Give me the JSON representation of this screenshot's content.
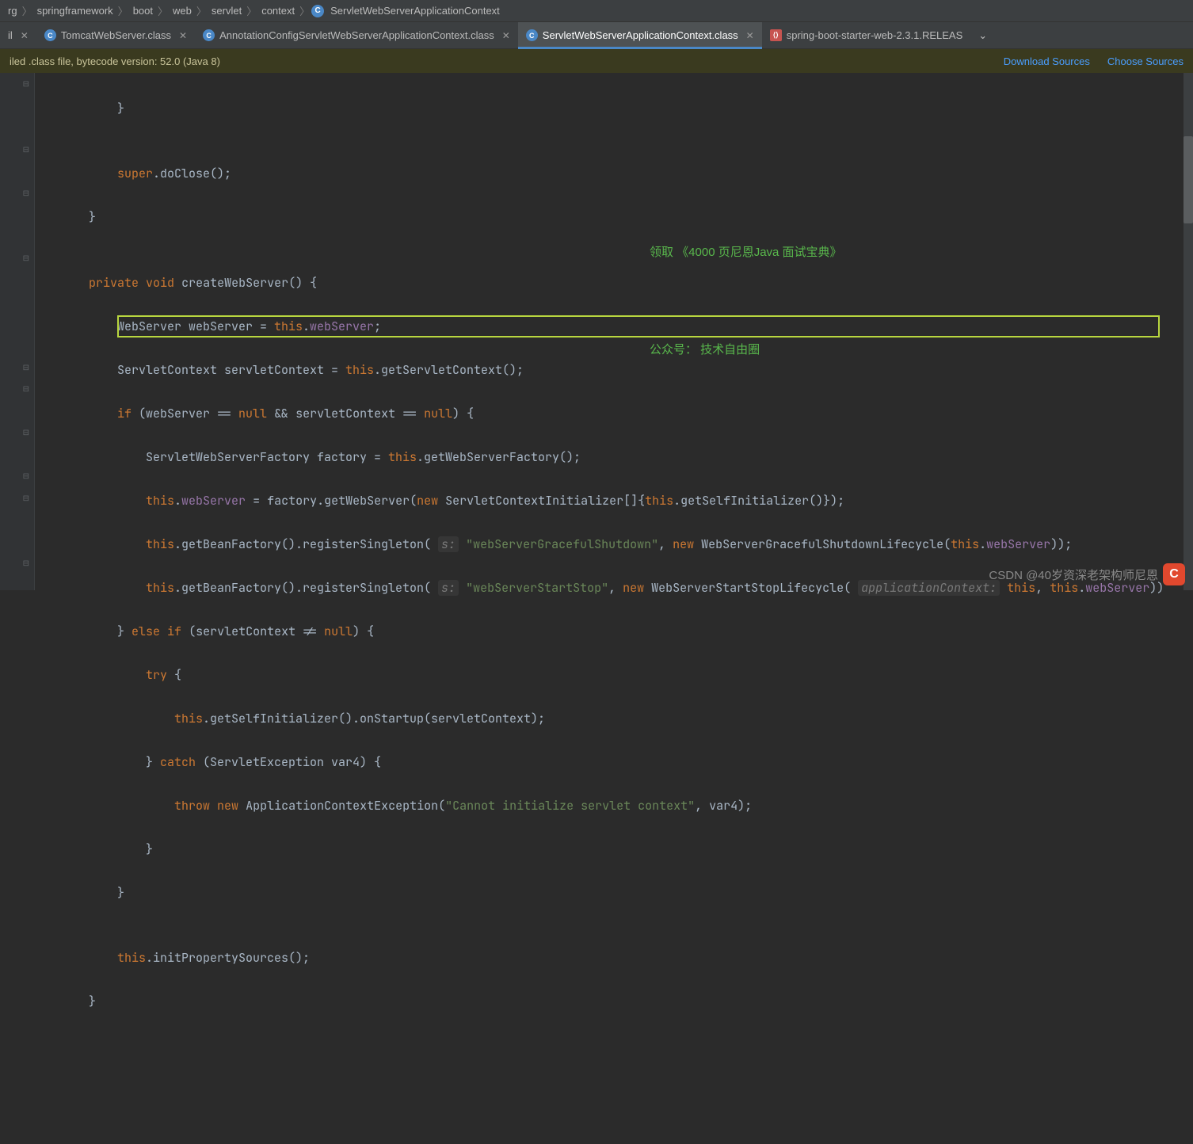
{
  "breadcrumb": {
    "items": [
      "rg",
      "springframework",
      "boot",
      "web",
      "servlet",
      "context"
    ],
    "current": "ServletWebServerApplicationContext"
  },
  "tabs": {
    "left": "il",
    "items": [
      {
        "label": "TomcatWebServer.class",
        "icon": "C",
        "active": false
      },
      {
        "label": "AnnotationConfigServletWebServerApplicationContext.class",
        "icon": "C",
        "active": false
      },
      {
        "label": "ServletWebServerApplicationContext.class",
        "icon": "C",
        "active": true
      },
      {
        "label": "spring-boot-starter-web-2.3.1.RELEAS",
        "icon": "xml",
        "active": false
      }
    ]
  },
  "ribbon": {
    "msg": "iled .class file, bytecode version: 52.0 (Java 8)",
    "link1": "Download Sources",
    "link2": "Choose Sources"
  },
  "code": {
    "l1": "        }",
    "l2": "",
    "l3_a": "        ",
    "l3_kw": "super",
    "l3_b": ".doClose();",
    "l4": "    }",
    "l5": "",
    "l6_a": "    ",
    "l6_kw1": "private",
    "l6_kw2": "void",
    "l6_b": " createWebServer() {",
    "l7_a": "        WebServer webServer = ",
    "l7_kw": "this",
    "l7_b": ".",
    "l7_f": "webServer",
    "l7_c": ";",
    "l8_a": "        ServletContext servletContext = ",
    "l8_kw": "this",
    "l8_b": ".getServletContext();",
    "l9_a": "        ",
    "l9_kw1": "if",
    "l9_b": " (webServer == ",
    "l9_kw2": "null",
    "l9_c": " && servletContext == ",
    "l9_kw3": "null",
    "l9_d": ") {",
    "l10_a": "            ServletWebServerFactory factory = ",
    "l10_kw": "this",
    "l10_b": ".getWebServerFactory();",
    "l11_a": "            ",
    "l11_kw1": "this",
    "l11_b": ".",
    "l11_f": "webServer",
    "l11_c": " = factory.getWebServer(",
    "l11_kw2": "new",
    "l11_d": " ServletContextInitializer[]{",
    "l11_kw3": "this",
    "l11_e": ".getSelfInitializer()});",
    "l12_a": "            ",
    "l12_kw1": "this",
    "l12_b": ".getBeanFactory().registerSingleton( ",
    "l12_h": "s:",
    "l12_s": "\"webServerGracefulShutdown\"",
    "l12_c": ", ",
    "l12_kw2": "new",
    "l12_d": " WebServerGracefulShutdownLifecycle(",
    "l12_kw3": "this",
    "l12_e": ".",
    "l12_f": "webServer",
    "l12_g": "));",
    "l13_a": "            ",
    "l13_kw1": "this",
    "l13_b": ".getBeanFactory().registerSingleton( ",
    "l13_h": "s:",
    "l13_s": "\"webServerStartStop\"",
    "l13_c": ", ",
    "l13_kw2": "new",
    "l13_d": " WebServerStartStopLifecycle( ",
    "l13_h2": "applicationContext:",
    "l13_e": " ",
    "l13_kw3": "this",
    "l13_f": ", ",
    "l13_kw4": "this",
    "l13_g": ".",
    "l13_fl": "webServer",
    "l13_i": "))",
    "l14_a": "        } ",
    "l14_kw1": "else",
    "l14_kw2": "if",
    "l14_b": " (servletContext != ",
    "l14_kw3": "null",
    "l14_c": ") {",
    "l15_a": "            ",
    "l15_kw": "try",
    "l15_b": " {",
    "l16_a": "                ",
    "l16_kw": "this",
    "l16_b": ".getSelfInitializer().onStartup(servletContext);",
    "l17_a": "            } ",
    "l17_kw": "catch",
    "l17_b": " (ServletException var4) {",
    "l18_a": "                ",
    "l18_kw1": "throw",
    "l18_kw2": "new",
    "l18_b": " ApplicationContextException(",
    "l18_s": "\"Cannot initialize servlet context\"",
    "l18_c": ", var4);",
    "l19": "            }",
    "l20": "        }",
    "l21": "",
    "l22_a": "        ",
    "l22_kw": "this",
    "l22_b": ".initPropertySources();",
    "l23": "    }"
  },
  "annotation": {
    "line1": "领取 《4000 页尼恩Java 面试宝典》",
    "line2": "公众号： 技术自由圈"
  },
  "watermark": {
    "text": "CSDN @40岁资深老架构师尼恩"
  }
}
